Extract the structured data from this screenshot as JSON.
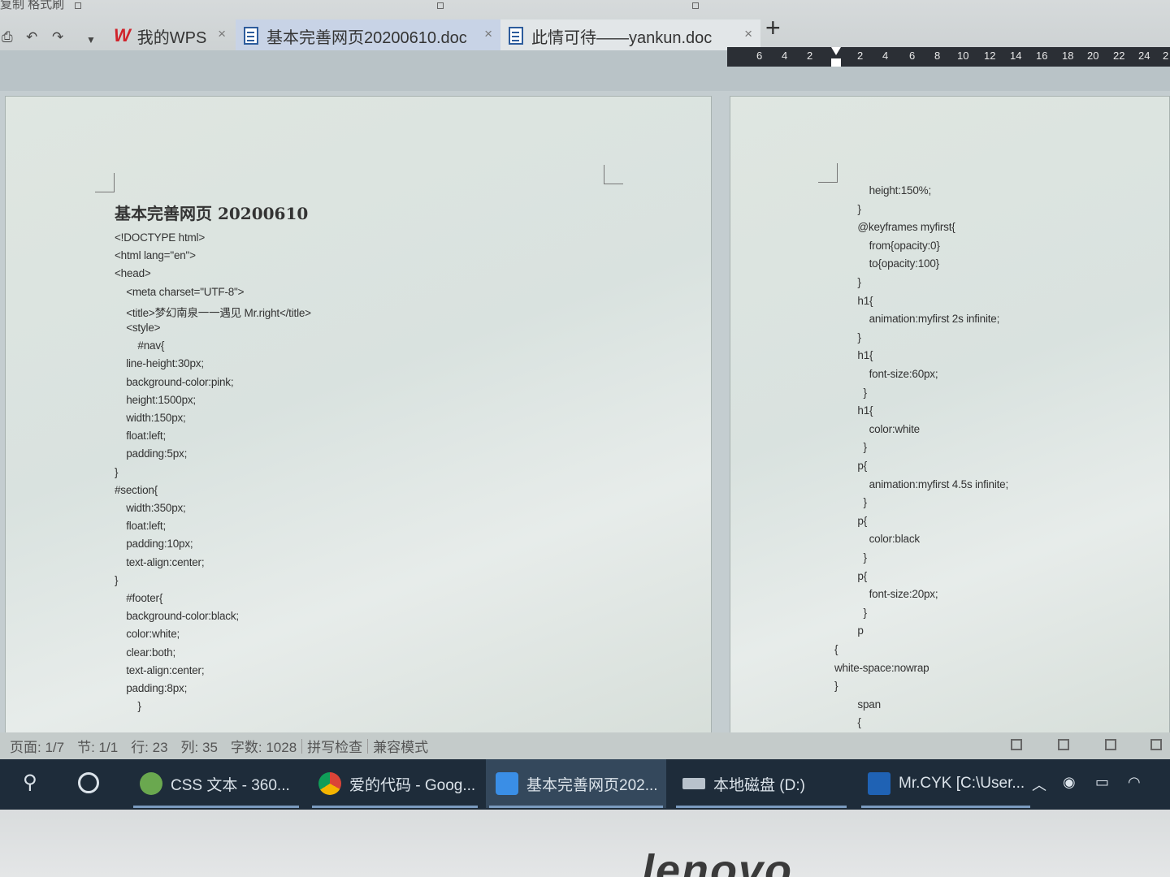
{
  "window": {
    "top_text": "复制 格式刷"
  },
  "tabs": [
    {
      "label": "我的WPS",
      "icon": "wps-logo-icon",
      "close": "×"
    },
    {
      "label": "基本完善网页20200610.doc",
      "icon": "doc-icon",
      "close": "×"
    },
    {
      "label": "此情可待——yankun.doc",
      "icon": "doc-icon",
      "close": "×"
    }
  ],
  "new_tab": "+",
  "ruler": {
    "left_ticks": [
      "6",
      "4",
      "2"
    ],
    "right_ticks": [
      "2",
      "4",
      "6",
      "8",
      "10",
      "12",
      "14",
      "16",
      "18",
      "20",
      "22",
      "24",
      "2"
    ]
  },
  "page1": {
    "title": "基本完善网页 20200610",
    "lines": [
      "<!DOCTYPE html>",
      "<html lang=\"en\">",
      "<head>",
      "    <meta charset=\"UTF-8\">",
      "    <title>梦幻南泉一一遇见 Mr.right</title>",
      "    <style>",
      "        #nav{",
      "    line-height:30px;",
      "    background-color:pink;",
      "    height:1500px;",
      "    width:150px;",
      "    float:left;",
      "    padding:5px;",
      "}",
      "#section{",
      "    width:350px;",
      "    float:left;",
      "    padding:10px;",
      "    text-align:center;",
      "}",
      "    #footer{",
      "    background-color:black;",
      "    color:white;",
      "    clear:both;",
      "    text-align:center;",
      "    padding:8px;",
      "        }",
      "        "
    ]
  },
  "page2": {
    "lines": [
      "            height:150%;",
      "        }",
      "        @keyframes myfirst{",
      "            from{opacity:0}",
      "            to{opacity:100}",
      "        }",
      "        h1{",
      "            animation:myfirst 2s infinite;",
      "        }",
      "        h1{",
      "            font-size:60px;",
      "          }",
      "        h1{",
      "            color:white",
      "          }",
      "        p{",
      "            animation:myfirst 4.5s infinite;",
      "          }",
      "        p{",
      "            color:black",
      "          }",
      "        p{",
      "            font-size:20px;",
      "          }",
      "        p",
      "{",
      "white-space:nowrap",
      "}",
      "        span",
      "        {"
    ]
  },
  "status": {
    "page": "页面: 1/7",
    "section": "节: 1/1",
    "row": "行: 23",
    "col": "列: 35",
    "words": "字数: 1028",
    "spell": "拼写检查",
    "compat": "兼容模式"
  },
  "taskbar": {
    "items": [
      {
        "label": "CSS 文本 - 360...",
        "icon": "360-browser-icon"
      },
      {
        "label": "爱的代码 - Goog...",
        "icon": "chrome-icon"
      },
      {
        "label": "基本完善网页202...",
        "icon": "wps-writer-icon",
        "active": true
      },
      {
        "label": "本地磁盘 (D:)",
        "icon": "drive-icon"
      },
      {
        "label": "Mr.CYK [C:\\User...",
        "icon": "webstorm-icon"
      }
    ]
  },
  "laptop_brand": "lenovo",
  "colors": {
    "taskbar_bg": "#1e2c3a",
    "active_tab": "#c8d3e6",
    "wps_red": "#d0232b"
  }
}
